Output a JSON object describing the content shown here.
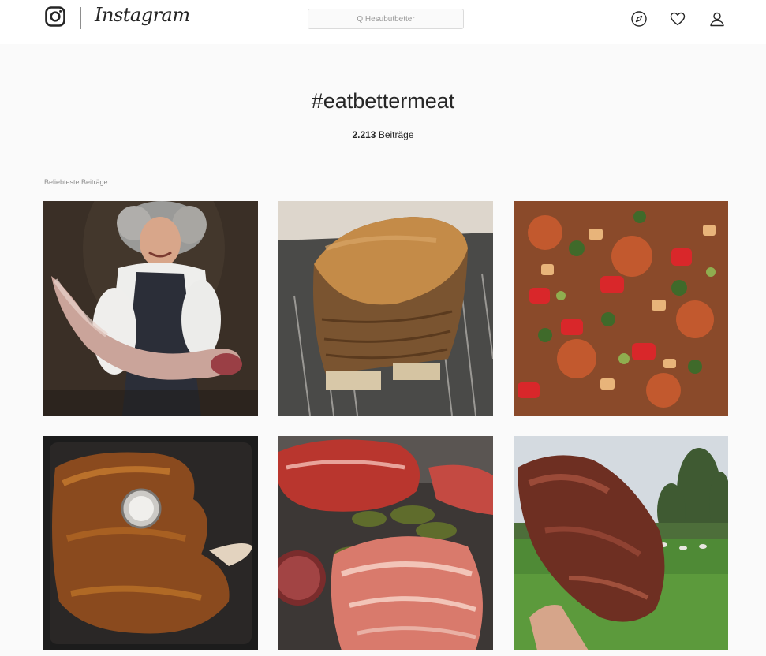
{
  "app": {
    "wordmark": "Instagram"
  },
  "search": {
    "placeholder": "Q Hesubutbetter"
  },
  "nav": {
    "icons": [
      "explore-compass-icon",
      "heart-icon",
      "profile-icon"
    ]
  },
  "hashtag": {
    "title": "#eatbettermeat",
    "post_count": "2.213",
    "post_count_unit": "Beiträge"
  },
  "section": {
    "label": "Beliebteste Beiträge"
  },
  "posts": [
    {
      "subject": "woman holding raw leg of lamb"
    },
    {
      "subject": "crispy pork roast on rack"
    },
    {
      "subject": "chopped vegetables and meat"
    },
    {
      "subject": "roasted rib steak with thermometer"
    },
    {
      "subject": "cured ham slices and pickles"
    },
    {
      "subject": "hand holding roast beef outdoors"
    }
  ],
  "colors": {
    "background": "#fafafa",
    "text": "#262626",
    "muted": "#8e8e8e",
    "border": "#dbdbdb"
  }
}
